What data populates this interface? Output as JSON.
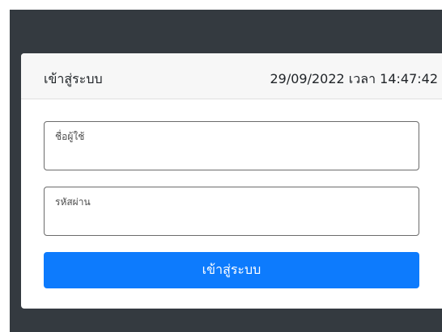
{
  "login_card": {
    "title": "เข้าสู่ระบบ",
    "datetime": "29/09/2022 เวลา 14:47:42",
    "username": {
      "label": "ชื่อผู้ใช้",
      "value": ""
    },
    "password": {
      "label": "รหัสผ่าน",
      "value": ""
    },
    "submit_label": "เข้าสู่ระบบ"
  },
  "colors": {
    "background": "#343a40",
    "header_background": "#f7f7f7",
    "button": "#0d7bfd",
    "button_text": "#ffffff"
  }
}
